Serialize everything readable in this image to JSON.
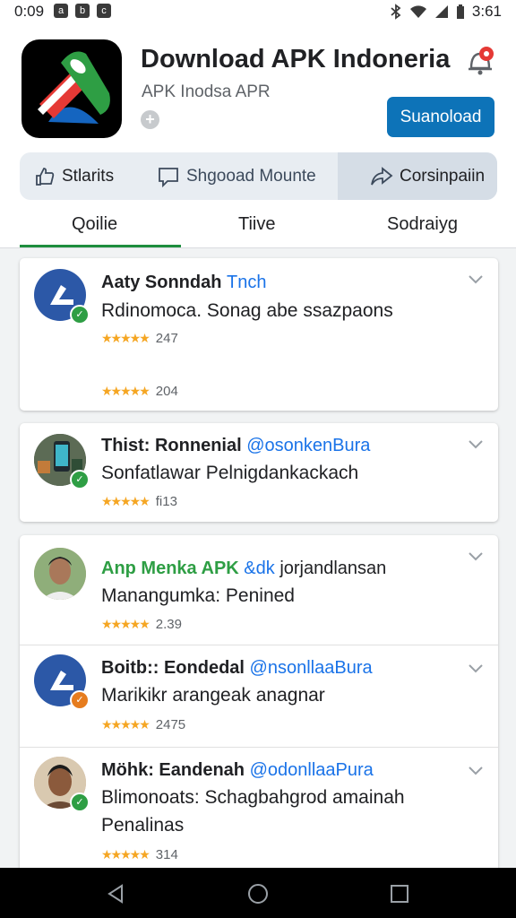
{
  "status_bar": {
    "time": "0:09",
    "notification_icons": [
      "a",
      "b",
      "c"
    ],
    "clock": "3:61"
  },
  "app": {
    "title": "Download APK Indoneria",
    "subtitle": "APK Inodsa APR",
    "download_label": "Suanoload"
  },
  "actions": [
    {
      "label": "Stlarits",
      "icon": "thumbs-up-icon"
    },
    {
      "label": "Shgooad Mounte",
      "icon": "message-icon"
    },
    {
      "label": "Corsinpaiin",
      "icon": "share-icon"
    }
  ],
  "tabs": [
    {
      "label": "Qoilie",
      "active": true
    },
    {
      "label": "Tiive",
      "active": false
    },
    {
      "label": "Sodraiyg",
      "active": false
    }
  ],
  "items": [
    {
      "name": "Aaty Sonndah",
      "handle": "Tnch",
      "desc": "Rdinomoca. Sonag abe ssazpaons",
      "rating_a": "247",
      "rating_b": "204"
    },
    {
      "name": "Thist: Ronnenial",
      "handle": "@osonkenBura",
      "desc": "Sonfatlawar Pelnigdankackach",
      "rating_a": "fi13"
    },
    {
      "name_green": "Anp Menka APK",
      "handle": "&dk",
      "name_tail": "jorjandlansan",
      "desc": "Manangumka: Penined",
      "rating_a": "2.39"
    },
    {
      "name": "Boitb:: Eondedal",
      "handle": "@nsonllaaBura",
      "desc": "Marikikr arangeak anagnar",
      "rating_a": "2475"
    },
    {
      "name": "Möhk: Eandenah",
      "handle": "@odonllaaPura",
      "desc": "Blimonoats: Schagbahgrod amainah",
      "desc2": "Penalinas",
      "rating_a": "314"
    }
  ],
  "colors": {
    "accent_blue": "#0d73b8",
    "tab_green": "#1e8e3e",
    "star": "#f5a623",
    "handle_blue": "#1a73e8"
  }
}
